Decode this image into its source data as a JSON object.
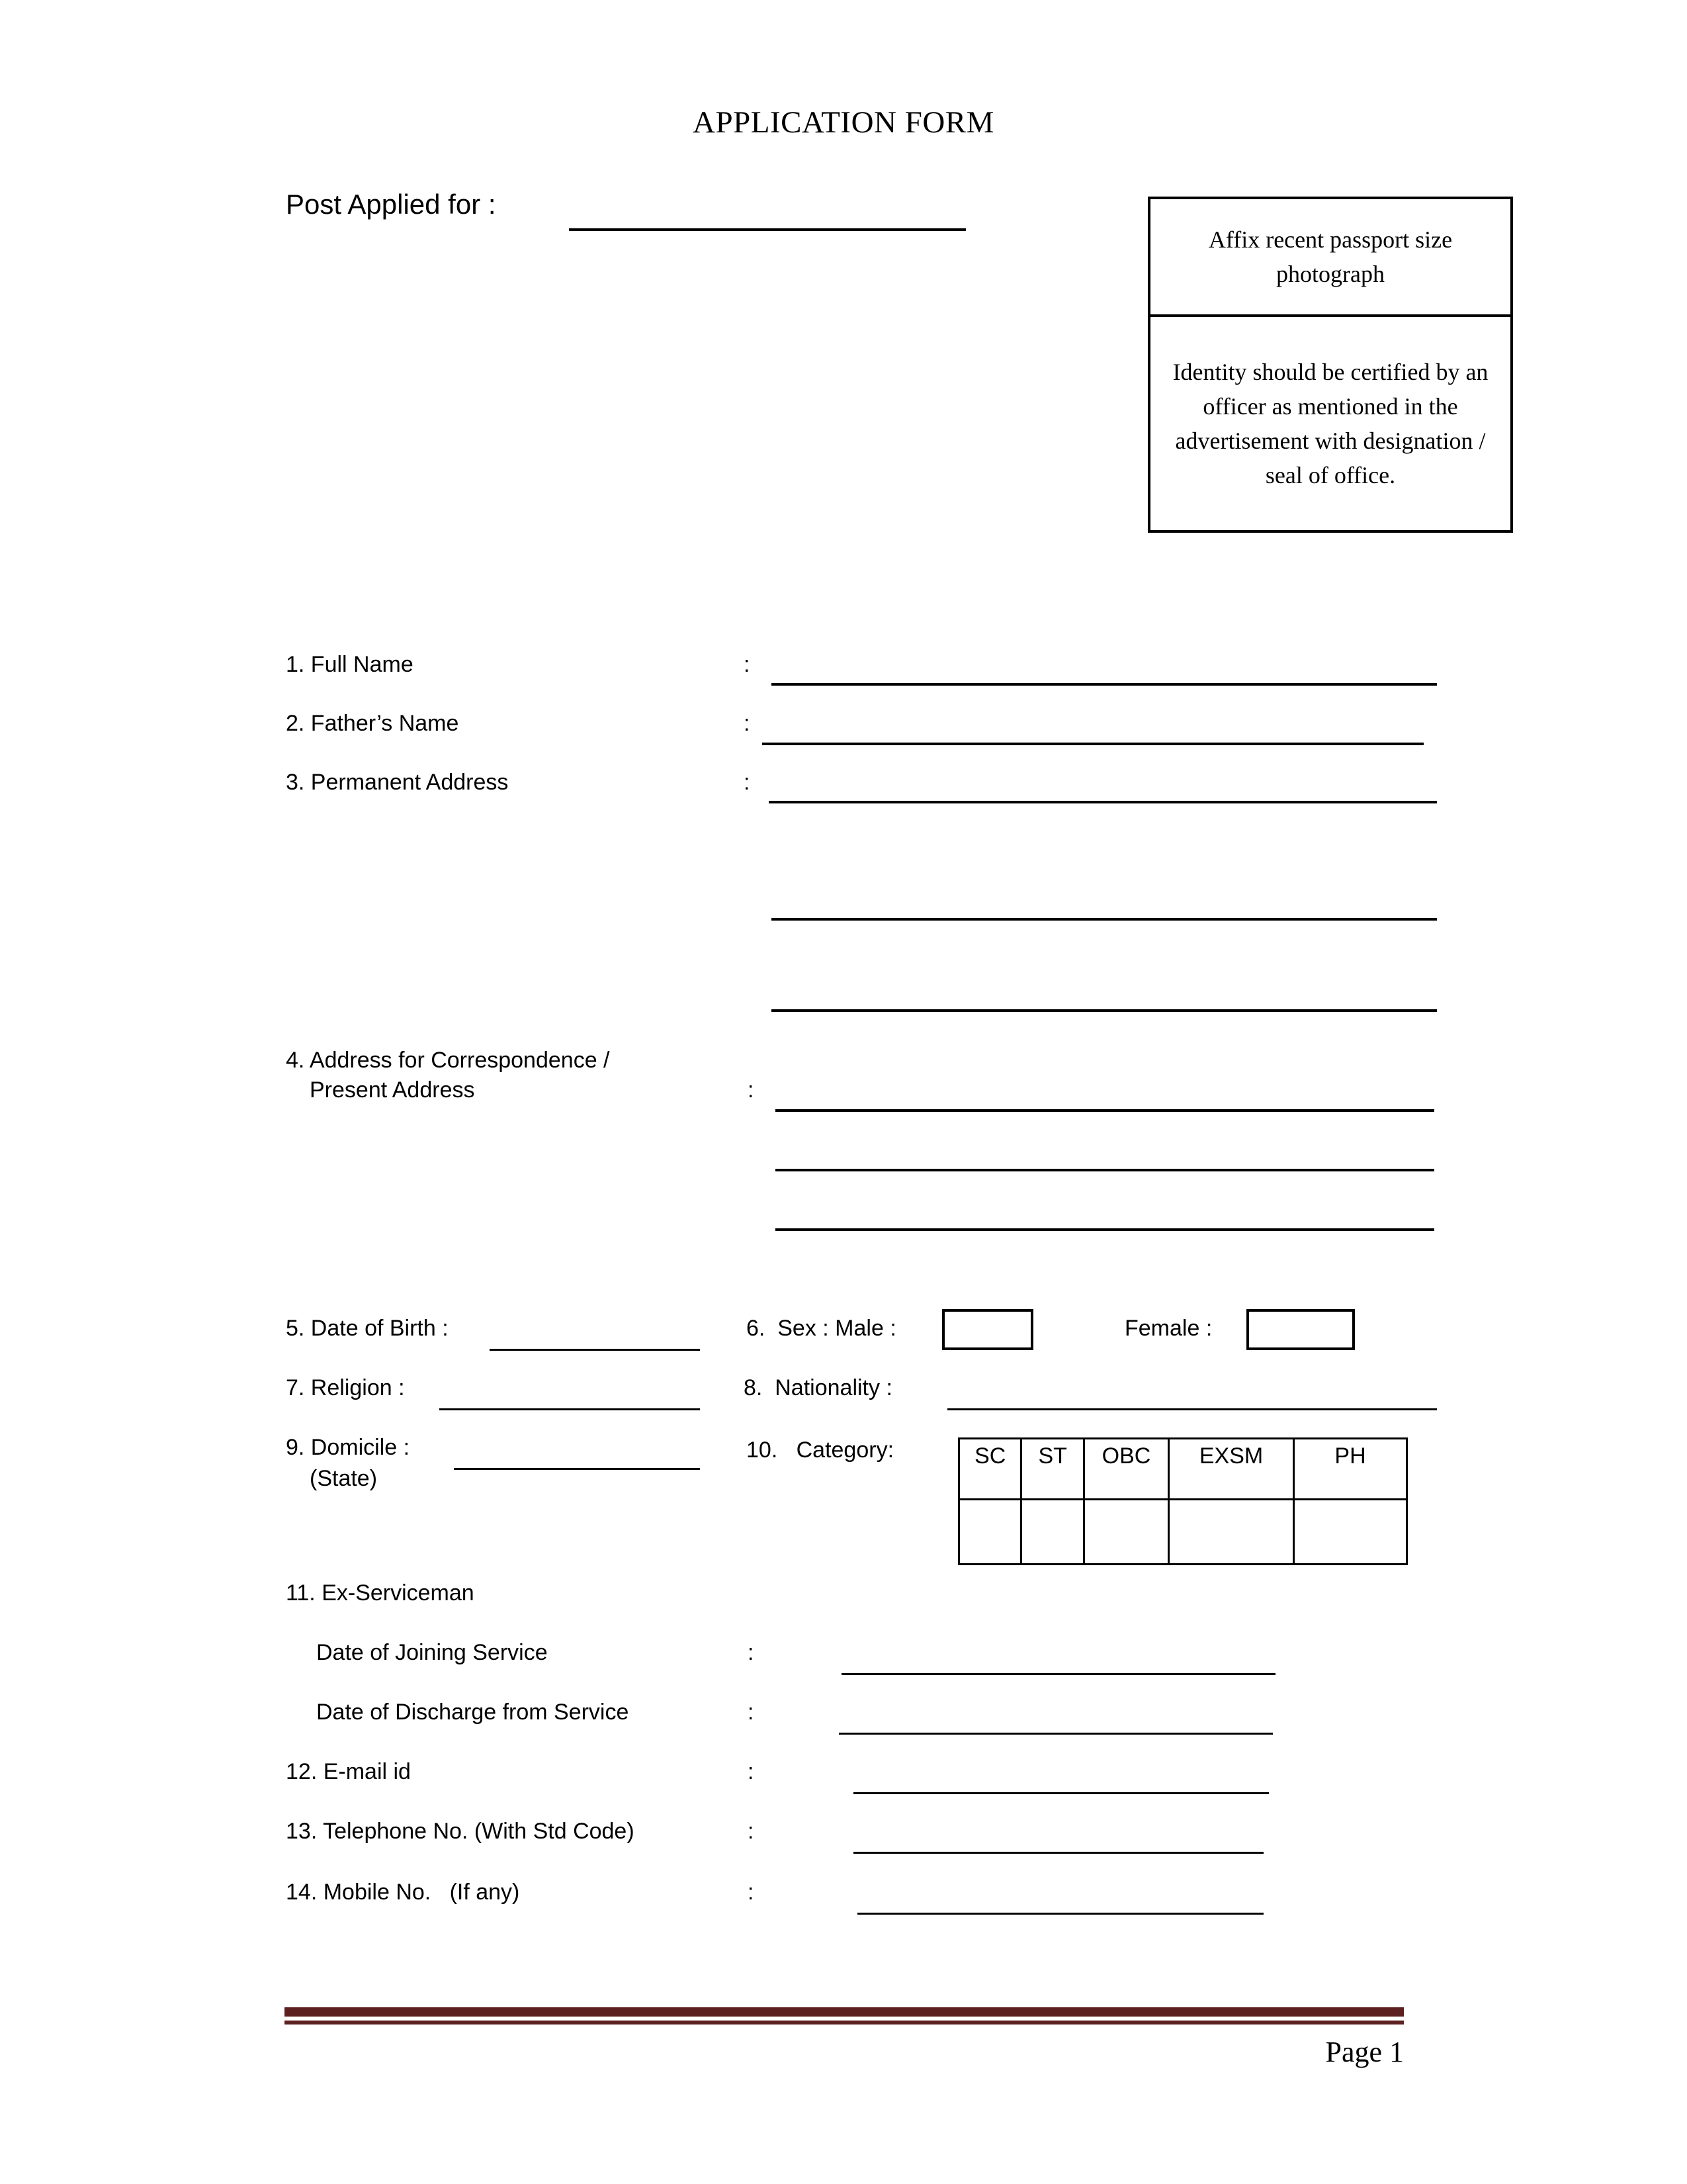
{
  "document": {
    "title": "APPLICATION FORM",
    "page_label": "Page 1",
    "footer_rule_color": "#5c2020"
  },
  "post_applied": {
    "label": "Post Applied for  :",
    "value": ""
  },
  "photo_box": {
    "affix_text": "Affix recent passport size photograph",
    "certify_text": "Identity should be certified by an officer as mentioned in the advertisement with designation / seal of office."
  },
  "fields": {
    "full_name": {
      "number": "1.",
      "label": "1. Full Name",
      "colon": ":",
      "value": ""
    },
    "fathers_name": {
      "number": "2.",
      "label": "2. Father’s Name",
      "colon": ":",
      "value": ""
    },
    "permanent_address": {
      "number": "3.",
      "label": "3. Permanent Address",
      "colon": ":",
      "value": "",
      "extra_lines": 2
    },
    "correspondence_address": {
      "number": "4.",
      "label_line1": "4. Address for Correspondence /",
      "label_line2": "Present Address",
      "colon": ":",
      "value": "",
      "extra_lines": 2
    },
    "date_of_birth": {
      "number": "5.",
      "label": "5. Date of Birth :",
      "value": ""
    },
    "sex": {
      "number": "6.",
      "label": "6.  Sex : Male :",
      "female_label": "Female :",
      "male_value": "",
      "female_value": ""
    },
    "religion": {
      "number": "7.",
      "label": "7. Religion :",
      "value": ""
    },
    "nationality": {
      "number": "8.",
      "label": "8.  Nationality :",
      "value": ""
    },
    "domicile": {
      "number": "9.",
      "label": "9. Domicile :",
      "sub_label": "(State)",
      "value": ""
    },
    "category": {
      "number": "10.",
      "label": "10.   Category:",
      "columns": [
        "SC",
        "ST",
        "OBC",
        "EXSM",
        "PH"
      ],
      "values": [
        "",
        "",
        "",
        "",
        ""
      ]
    },
    "ex_serviceman": {
      "number": "11.",
      "label": "11. Ex-Serviceman",
      "date_of_joining": {
        "label": "Date of Joining Service",
        "colon": ":",
        "value": ""
      },
      "date_of_discharge": {
        "label": "Date of Discharge from Service",
        "colon": ":",
        "value": ""
      }
    },
    "email": {
      "number": "12.",
      "label": "12. E-mail id",
      "colon": ":",
      "value": ""
    },
    "telephone": {
      "number": "13.",
      "label": "13. Telephone No. (With Std Code)",
      "colon": ":",
      "value": ""
    },
    "mobile": {
      "number": "14.",
      "label": "14. Mobile No.   (If any)",
      "colon": ":",
      "value": ""
    }
  }
}
